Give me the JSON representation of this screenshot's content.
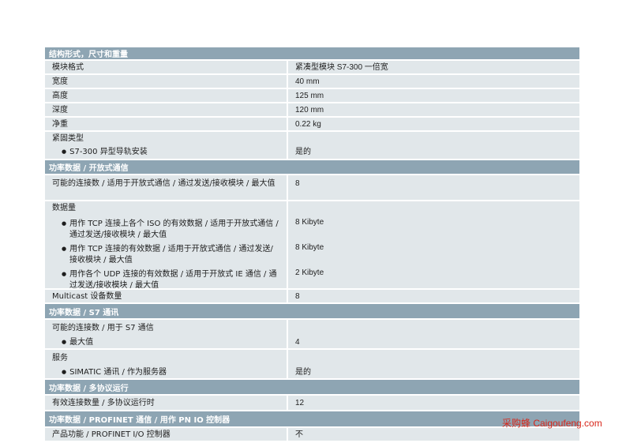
{
  "sections": [
    {
      "title": "结构形式，尺寸和重量",
      "rows": [
        {
          "label": "模块格式",
          "value": "紧凑型模块 S7-300 一倍宽"
        },
        {
          "label": "宽度",
          "value": "40 mm"
        },
        {
          "label": "高度",
          "value": "125 mm"
        },
        {
          "label": "深度",
          "value": "120 mm"
        },
        {
          "label": "净重",
          "value": "0.22 kg"
        },
        {
          "label": "紧固类型",
          "value": ""
        },
        {
          "label": "S7-300 异型导轨安装",
          "value": "是的"
        }
      ]
    },
    {
      "title": "功率数据 / 开放式通信",
      "rows": [
        {
          "label": "可能的连接数 / 适用于开放式通信 / 通过发送/接收模块 / 最大值",
          "value": "8"
        },
        {
          "label": "数据量",
          "value": ""
        },
        {
          "label": "用作 TCP 连接上各个 ISO 的有效数据 / 适用于开放式通信 / 通过发送/接收模块 / 最大值",
          "value": "8 Kibyte"
        },
        {
          "label": "用作 TCP 连接的有效数据 / 适用于开放式通信 / 通过发送/接收模块 / 最大值",
          "value": "8 Kibyte"
        },
        {
          "label": "用作各个 UDP 连接的有效数据 / 适用于开放式 IE 通信 / 通过发送/接收模块 / 最大值",
          "value": "2 Kibyte"
        },
        {
          "label": "Multicast 设备数量",
          "value": "8"
        }
      ]
    },
    {
      "title": "功率数据 / S7 通讯",
      "rows": [
        {
          "label": "可能的连接数 / 用于 S7 通信",
          "value": ""
        },
        {
          "label": "最大值",
          "value": "4"
        },
        {
          "label": "服务",
          "value": ""
        },
        {
          "label": "SIMATIC 通讯 / 作为服务器",
          "value": "是的"
        }
      ]
    },
    {
      "title": "功率数据 / 多协议运行",
      "rows": [
        {
          "label": "有效连接数量 / 多协议运行时",
          "value": "12"
        }
      ]
    },
    {
      "title": "功率数据 / PROFINET 通信 / 用作 PN IO 控制器",
      "rows": [
        {
          "label": "产品功能 / PROFINET I/O 控制器",
          "value": "不"
        }
      ]
    }
  ],
  "watermark": "采购蜂 Caigoufeng.com"
}
